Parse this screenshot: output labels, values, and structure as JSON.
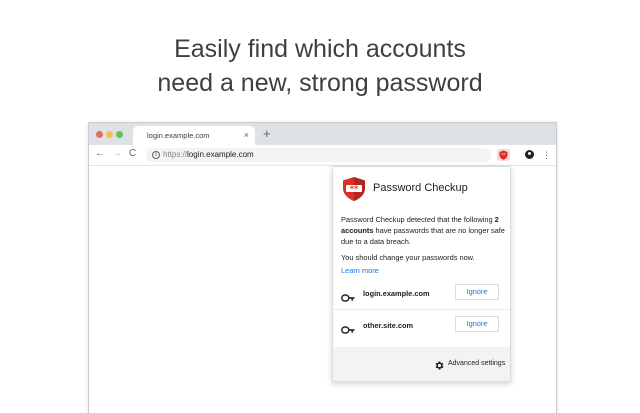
{
  "headline": {
    "line1": "Easily find which accounts",
    "line2": "need a new, strong password"
  },
  "browser": {
    "tab_title": "login.example.com",
    "tab_close": "×",
    "new_tab": "+",
    "url_protocol": "https://",
    "url_host": "login.example.com",
    "nav_back": "←",
    "nav_forward": "→",
    "nav_reload": "C",
    "menu": "⋮",
    "info": "i"
  },
  "popup": {
    "title": "Password Checkup",
    "desc_before": "Password Checkup detected that the following ",
    "desc_bold": "2 accounts",
    "desc_after": " have passwords that are no longer safe due to a data breach.",
    "advice": "You should change your passwords now.",
    "learn_more": "Learn more",
    "accounts": [
      {
        "name": "login.example.com",
        "button": "Ignore"
      },
      {
        "name": "other.site.com",
        "button": "Ignore"
      }
    ],
    "footer": "Advanced settings"
  },
  "colors": {
    "accent": "#1a73e8",
    "brand_red": "#d93025"
  },
  "icons": [
    "info-icon",
    "password-checkup-extension-icon",
    "profile-icon",
    "menu-icon",
    "password-checkup-logo-icon",
    "key-icon",
    "gear-icon"
  ]
}
